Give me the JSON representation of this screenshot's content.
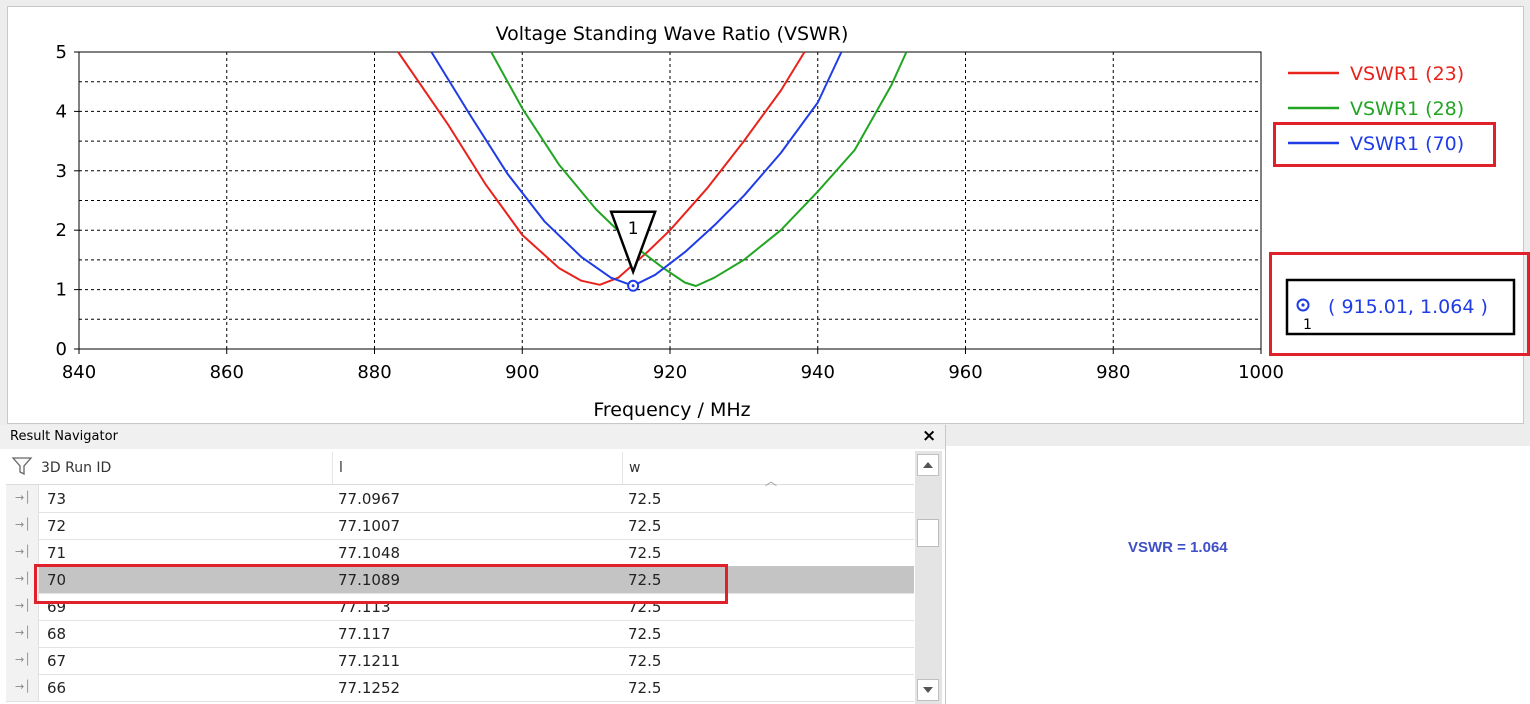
{
  "chart_data": {
    "type": "line",
    "title": "Voltage Standing Wave Ratio (VSWR)",
    "xlabel": "Frequency / MHz",
    "ylabel": "",
    "xlim": [
      840,
      1000
    ],
    "ylim": [
      0,
      5
    ],
    "xticks": [
      "840",
      "860",
      "880",
      "900",
      "920",
      "940",
      "960",
      "980",
      "1000"
    ],
    "yticks": [
      "0",
      "1",
      "2",
      "3",
      "4",
      "5"
    ],
    "grid": true,
    "legend_position": "right",
    "series": [
      {
        "name": "VSWR1 (23)",
        "color": "#e8231c",
        "x": [
          883.2,
          890,
          895,
          900,
          905,
          908,
          910.5,
          913,
          917,
          920,
          925,
          930,
          935,
          938.2
        ],
        "y": [
          5.0,
          3.77,
          2.78,
          1.92,
          1.36,
          1.15,
          1.08,
          1.2,
          1.64,
          2.0,
          2.7,
          3.5,
          4.35,
          5.0
        ]
      },
      {
        "name": "VSWR1 (28)",
        "color": "#22a522",
        "x": [
          895.8,
          900,
          905,
          910,
          915,
          919,
          922,
          923.5,
          926,
          930,
          935,
          940,
          945,
          950,
          952
        ],
        "y": [
          5.0,
          4.05,
          3.1,
          2.35,
          1.75,
          1.37,
          1.12,
          1.06,
          1.2,
          1.5,
          2.0,
          2.65,
          3.35,
          4.45,
          5.0
        ]
      },
      {
        "name": "VSWR1 (70)",
        "color": "#1f3ce6",
        "x": [
          887.7,
          893,
          898,
          903,
          908,
          912,
          915,
          918,
          922,
          926,
          930,
          935,
          940,
          943.2
        ],
        "y": [
          5.0,
          3.93,
          2.95,
          2.15,
          1.55,
          1.2,
          1.064,
          1.25,
          1.63,
          2.08,
          2.58,
          3.3,
          4.15,
          5.0
        ]
      }
    ],
    "marker": {
      "label": "1",
      "x": 915.01,
      "y": 1.064,
      "readout": "( 915.01, 1.064 )"
    }
  },
  "navigator": {
    "title": "Result Navigator",
    "close_label": "×",
    "columns": [
      "3D Run ID",
      "l",
      "w"
    ],
    "rows": [
      {
        "id": "73",
        "l": "77.0967",
        "w": "72.5",
        "selected": false
      },
      {
        "id": "72",
        "l": "77.1007",
        "w": "72.5",
        "selected": false
      },
      {
        "id": "71",
        "l": "77.1048",
        "w": "72.5",
        "selected": false
      },
      {
        "id": "70",
        "l": "77.1089",
        "w": "72.5",
        "selected": true
      },
      {
        "id": "69",
        "l": "77.113",
        "w": "72.5",
        "selected": false
      },
      {
        "id": "68",
        "l": "77.117",
        "w": "72.5",
        "selected": false
      },
      {
        "id": "67",
        "l": "77.1211",
        "w": "72.5",
        "selected": false
      },
      {
        "id": "66",
        "l": "77.1252",
        "w": "72.5",
        "selected": false
      }
    ]
  },
  "annotation": {
    "text": "VSWR = 1.064",
    "color": "#3f4fc4"
  }
}
